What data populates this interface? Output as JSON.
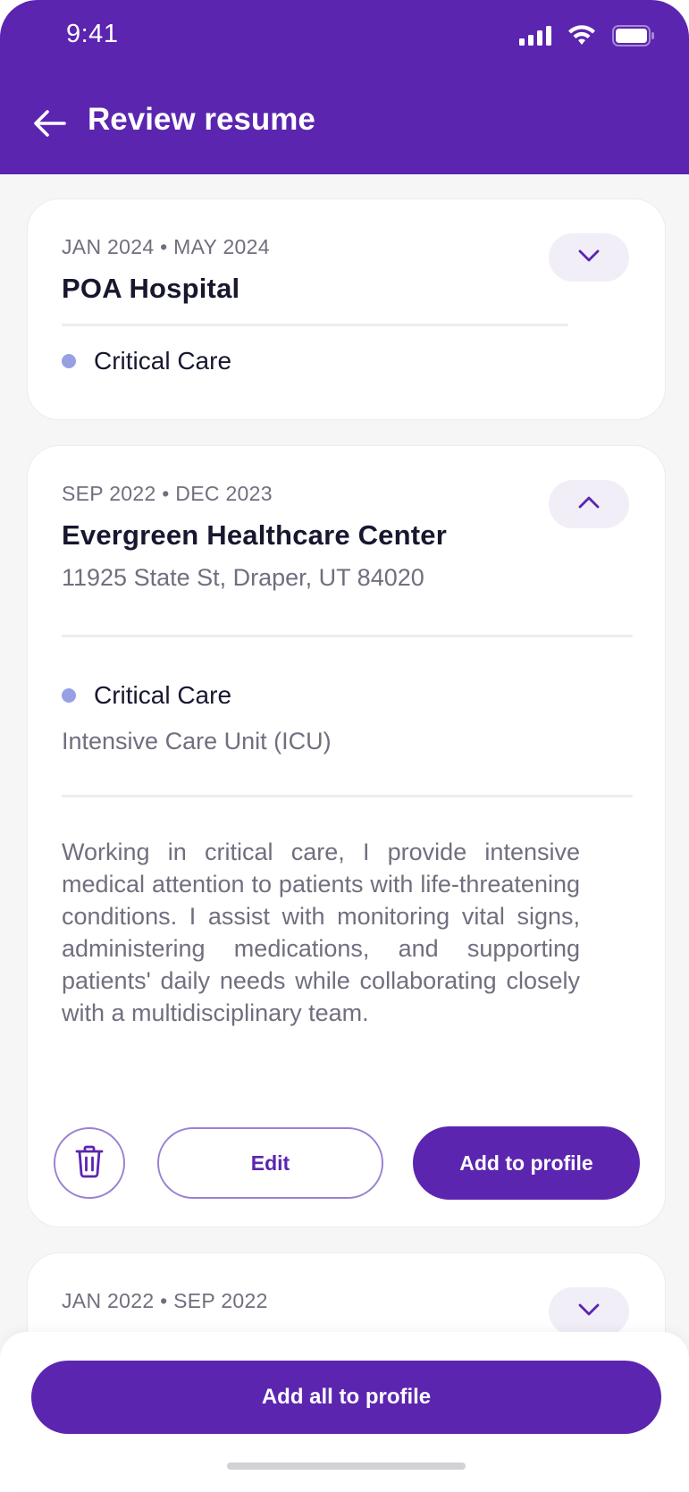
{
  "status_bar": {
    "time": "9:41",
    "icons": [
      "signal-icon",
      "wifi-icon",
      "battery-icon"
    ]
  },
  "header": {
    "back_icon": "arrow-left-icon",
    "title": "Review resume"
  },
  "colors": {
    "brand": "#5b25b0",
    "dot": "#98a0e4",
    "muted_text": "#6f6f7f",
    "surface": "#f6f6f7"
  },
  "cards": [
    {
      "dates": "JAN 2024 • MAY 2024",
      "name": "POA Hospital",
      "toggle_icon": "chevron-down-icon",
      "specialty": "Critical Care"
    },
    {
      "dates": "SEP 2022 • DEC 2023",
      "name": "Evergreen Healthcare Center",
      "address": "11925 State St, Draper, UT 84020",
      "toggle_icon": "chevron-up-icon",
      "specialty": "Critical Care",
      "unit": "Intensive Care Unit (ICU)",
      "description": "Working in critical care, I provide intensive medical attention to patients with life-threatening conditions. I assist with monitoring vital signs, administering medications, and supporting patients' daily needs while collaborating closely with a multidisciplinary team.",
      "delete_icon": "trash-icon",
      "edit_label": "Edit",
      "add_label": "Add to profile"
    },
    {
      "dates": "JAN 2022 • SEP 2022",
      "toggle_icon": "chevron-down-icon"
    }
  ],
  "footer": {
    "add_all_label": "Add all to profile"
  }
}
